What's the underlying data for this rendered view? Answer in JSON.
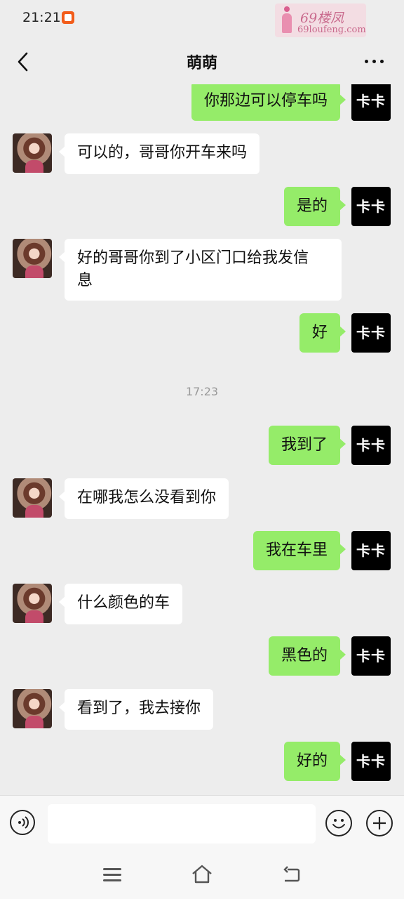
{
  "status": {
    "time": "21:21"
  },
  "watermark": {
    "line1": "69楼凤",
    "line2": "69loufeng.com"
  },
  "header": {
    "title": "萌萌"
  },
  "me_avatar_text": "卡卡",
  "messages": [
    {
      "from": "me",
      "text": "你那边可以停车吗"
    },
    {
      "from": "other",
      "text": "可以的，哥哥你开车来吗"
    },
    {
      "from": "me",
      "text": "是的"
    },
    {
      "from": "other",
      "line1": "好的哥哥你到了小区门口给我发信",
      "line2": "息"
    },
    {
      "from": "me",
      "text": "好"
    },
    {
      "time": "17:23"
    },
    {
      "from": "me",
      "text": "我到了"
    },
    {
      "from": "other",
      "text": "在哪我怎么没看到你"
    },
    {
      "from": "me",
      "text": "我在车里"
    },
    {
      "from": "other",
      "text": "什么颜色的车"
    },
    {
      "from": "me",
      "text": "黑色的"
    },
    {
      "from": "other",
      "text": "看到了，我去接你"
    },
    {
      "from": "me",
      "text": "好的"
    }
  ],
  "input": {
    "value": ""
  },
  "icons": {
    "back": "chevron-left-icon",
    "more": "more-dots-icon",
    "voice": "voice-icon",
    "emoji": "emoji-icon",
    "plus": "plus-icon",
    "nav_menu": "menu-icon",
    "nav_home": "home-icon",
    "nav_back": "back-icon"
  },
  "colors": {
    "background": "#ededed",
    "bubble_out": "#95ec69",
    "bubble_in": "#ffffff",
    "my_avatar": "#000000"
  }
}
